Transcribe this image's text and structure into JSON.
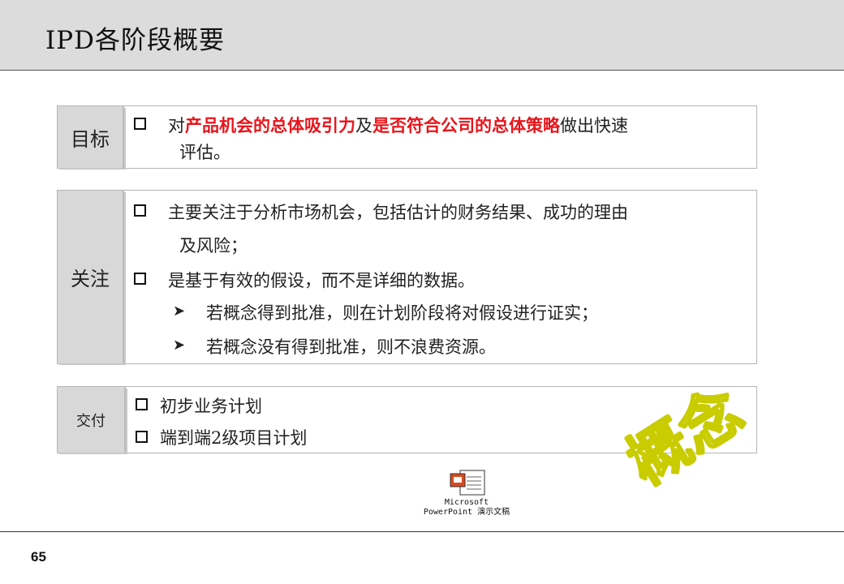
{
  "header": {
    "title": "IPD各阶段概要"
  },
  "goal": {
    "label": "目标",
    "line1_pre": "对",
    "line1_red1": "产品机会的总体吸引力",
    "line1_mid": "及",
    "line1_red2": "是否符合公司的总体策略",
    "line1_post": "做出快速",
    "line2": "评估。"
  },
  "focus": {
    "label": "关注",
    "item1_line1": "主要关注于分析市场机会，包括估计的财务结果、成功的理由",
    "item1_line2": "及风险；",
    "item2": "是基于有效的假设，而不是详细的数据。",
    "sub1": "若概念得到批准，则在计划阶段将对假设进行证实；",
    "sub2": "若概念没有得到批准，则不浪费资源。"
  },
  "deliver": {
    "label": "交付",
    "item1": "初步业务计划",
    "item2": "端到端2级项目计划"
  },
  "embedded": {
    "caption_line1": "Microsoft",
    "caption_line2": "PowerPoint 演示文稿"
  },
  "stamp": {
    "text": "概念",
    "color": "#c8cc00"
  },
  "footer": {
    "page_number": "65"
  }
}
